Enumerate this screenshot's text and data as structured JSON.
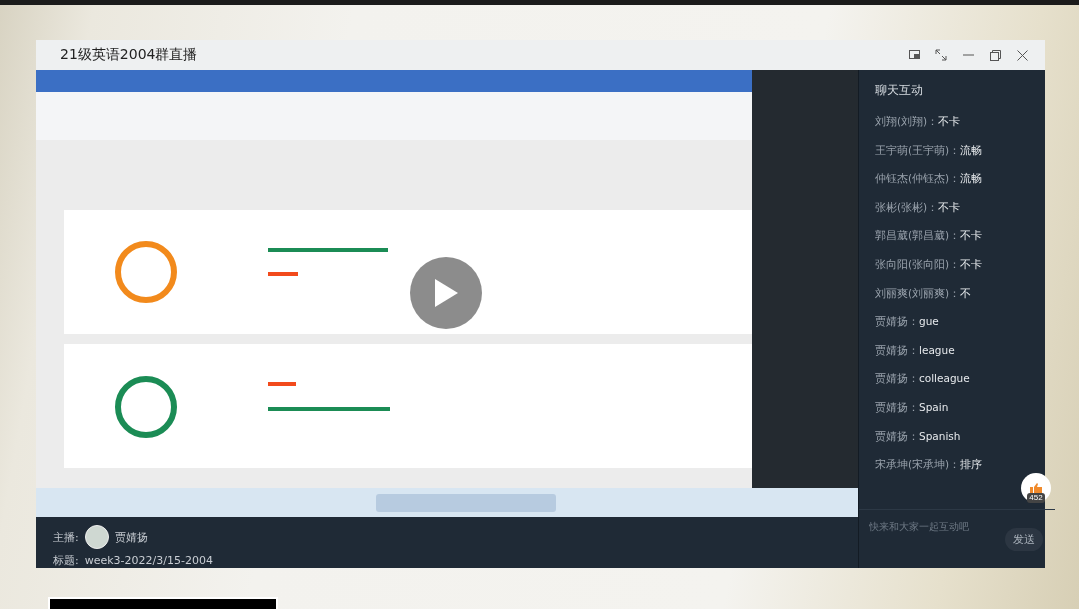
{
  "window": {
    "title": "21级英语2004群直播"
  },
  "video": {
    "paused": true
  },
  "chat": {
    "title": "聊天互动",
    "messages": [
      {
        "sender": "刘翔(刘翔)：",
        "text": "不卡"
      },
      {
        "sender": "王宇萌(王宇萌)：",
        "text": "流畅"
      },
      {
        "sender": "仲钰杰(仲钰杰)：",
        "text": "流畅"
      },
      {
        "sender": "张彬(张彬)：",
        "text": "不卡"
      },
      {
        "sender": "郭昌葳(郭昌葳)：",
        "text": "不卡"
      },
      {
        "sender": "张向阳(张向阳)：",
        "text": "不卡"
      },
      {
        "sender": "刘丽爽(刘丽爽)：",
        "text": "不"
      },
      {
        "sender": "贾婧扬：",
        "text": "gue"
      },
      {
        "sender": "贾婧扬：",
        "text": "league"
      },
      {
        "sender": "贾婧扬：",
        "text": "colleague"
      },
      {
        "sender": "贾婧扬：",
        "text": "Spain"
      },
      {
        "sender": "贾婧扬：",
        "text": "Spanish"
      },
      {
        "sender": "宋承坤(宋承坤)：",
        "text": "排序"
      }
    ],
    "like_count": "452",
    "input": {
      "placeholder": "快来和大家一起互动吧"
    },
    "send_button": "发送"
  },
  "info": {
    "host_label": "主播:",
    "host_name": "贾婧扬",
    "title_label": "标题:",
    "title": "week3-2022/3/15-2004"
  }
}
